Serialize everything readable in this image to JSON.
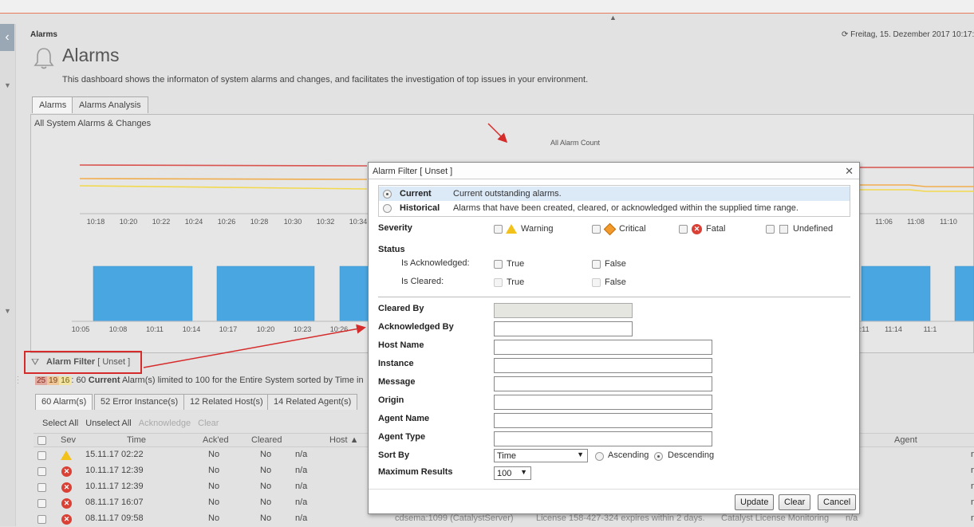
{
  "header": {
    "breadcrumb": "Alarms",
    "datetime": "Freitag, 15. Dezember 2017 10:17:",
    "title": "Alarms",
    "description": "This dashboard shows the informaton of system alarms and changes, and facilitates the investigation of top issues in your environment."
  },
  "main_tabs": [
    "Alarms",
    "Alarms Analysis"
  ],
  "panel": {
    "title": "All System Alarms & Changes",
    "chart_title": "All Alarm Count"
  },
  "chart_data": [
    {
      "type": "line",
      "title": "All Alarm Count",
      "x": [
        "10:18",
        "10:20",
        "10:22",
        "10:24",
        "10:26",
        "10:28",
        "10:30",
        "10:32",
        "10:34",
        "11:06",
        "11:08",
        "11:10"
      ],
      "series": [
        {
          "color": "#d9534f"
        },
        {
          "color": "#f0ad4e"
        },
        {
          "color": "#f2d94e"
        }
      ]
    },
    {
      "type": "bar",
      "x": [
        "10:05",
        "10:08",
        "10:11",
        "10:14",
        "10:17",
        "10:20",
        "10:23",
        "10:26",
        "11:11",
        "11:14",
        "11:1"
      ],
      "bar_color": "#4aa6e0"
    }
  ],
  "filter_anchor": {
    "label": "Alarm Filter",
    "state": "[ Unset ]"
  },
  "summary": {
    "count_red": "25",
    "count_orange": "19",
    "count_yellow": "16",
    "text_prefix": ": 60 ",
    "text_bold": "Current",
    "text_suffix": " Alarm(s) limited to 100 for the Entire System sorted by Time in"
  },
  "sub_tabs": [
    "60 Alarm(s)",
    "52 Error Instance(s)",
    "12 Related Host(s)",
    "14 Related Agent(s)"
  ],
  "table": {
    "actions": [
      {
        "label": "Select All",
        "enabled": true
      },
      {
        "label": "Unselect All",
        "enabled": true
      },
      {
        "label": "Acknowledge",
        "enabled": false
      },
      {
        "label": "Clear",
        "enabled": false
      }
    ],
    "headers": {
      "sev": "Sev",
      "time": "Time",
      "acked": "Ack'ed",
      "cleared": "Cleared",
      "host": "Host ▲",
      "agent": "Agent"
    },
    "rows": [
      {
        "sev": "warning",
        "time": "15.11.17 02:22",
        "acked": "No",
        "cleared": "No",
        "host": "n/a",
        "right": "n"
      },
      {
        "sev": "fatal",
        "time": "10.11.17 12:39",
        "acked": "No",
        "cleared": "No",
        "host": "n/a",
        "right": "n"
      },
      {
        "sev": "fatal",
        "time": "10.11.17 12:39",
        "acked": "No",
        "cleared": "No",
        "host": "n/a",
        "right": "n"
      },
      {
        "sev": "fatal",
        "time": "08.11.17 16:07",
        "acked": "No",
        "cleared": "No",
        "host": "n/a",
        "right": "n"
      },
      {
        "sev": "fatal",
        "time": "08.11.17 09:58",
        "acked": "No",
        "cleared": "No",
        "host": "n/a",
        "extra1": "cdsema:1099 (CatalystServer)",
        "extra2": "License 158-427-324 expires within 2 days.",
        "extra3": "Catalyst License Monitoring",
        "extra4": "n/a",
        "right": "n"
      }
    ]
  },
  "dialog": {
    "title": "Alarm Filter [ Unset ]",
    "close": "✕",
    "modes": [
      {
        "name": "Current",
        "desc": "Current outstanding alarms.",
        "selected": true
      },
      {
        "name": "Historical",
        "desc": "Alarms that have been created, cleared, or acknowledged within the supplied time range.",
        "selected": false
      }
    ],
    "severity_label": "Severity",
    "severities": [
      "Warning",
      "Critical",
      "Fatal",
      "Undefined"
    ],
    "status_label": "Status",
    "is_acknowledged_label": "Is Acknowledged:",
    "is_cleared_label": "Is Cleared:",
    "true_label": "True",
    "false_label": "False",
    "fields": [
      "Cleared By",
      "Acknowledged By",
      "Host Name",
      "Instance",
      "Message",
      "Origin",
      "Agent Name",
      "Agent Type"
    ],
    "sort_by_label": "Sort By",
    "sort_by_value": "Time",
    "ascending_label": "Ascending",
    "descending_label": "Descending",
    "max_results_label": "Maximum Results",
    "max_results_value": "100",
    "buttons": {
      "update": "Update",
      "clear": "Clear",
      "cancel": "Cancel"
    }
  }
}
